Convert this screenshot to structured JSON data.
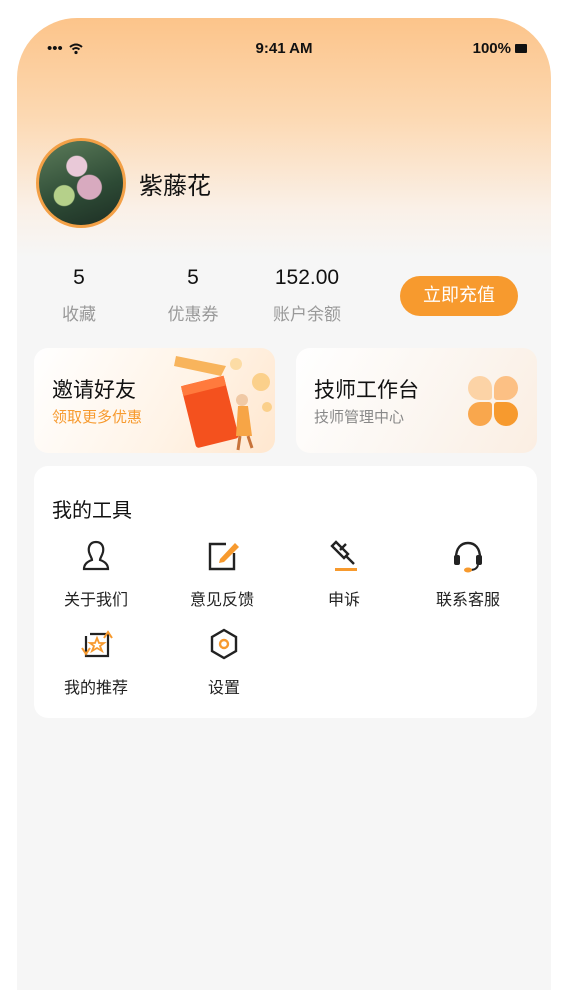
{
  "status_bar": {
    "signal": "•••",
    "time": "9:41 AM",
    "battery": "100%"
  },
  "profile": {
    "name": "紫藤花"
  },
  "stats": [
    {
      "value": "5",
      "label": "收藏"
    },
    {
      "value": "5",
      "label": "优惠券"
    },
    {
      "value": "152.00",
      "label": "账户余额"
    }
  ],
  "recharge_label": "立即充值",
  "invite_card": {
    "title": "邀请好友",
    "subtitle": "领取更多优惠"
  },
  "tech_card": {
    "title": "技师工作台",
    "subtitle": "技师管理中心"
  },
  "tools": {
    "title": "我的工具",
    "items": [
      {
        "label": "关于我们",
        "icon": "user-icon"
      },
      {
        "label": "意见反馈",
        "icon": "edit-icon"
      },
      {
        "label": "申诉",
        "icon": "gavel-icon"
      },
      {
        "label": "联系客服",
        "icon": "headset-icon"
      },
      {
        "label": "我的推荐",
        "icon": "recommend-icon"
      },
      {
        "label": "设置",
        "icon": "settings-icon"
      }
    ]
  },
  "colors": {
    "accent": "#f79a2e",
    "header_top": "#fcc48a",
    "background": "#f6f6f6"
  }
}
